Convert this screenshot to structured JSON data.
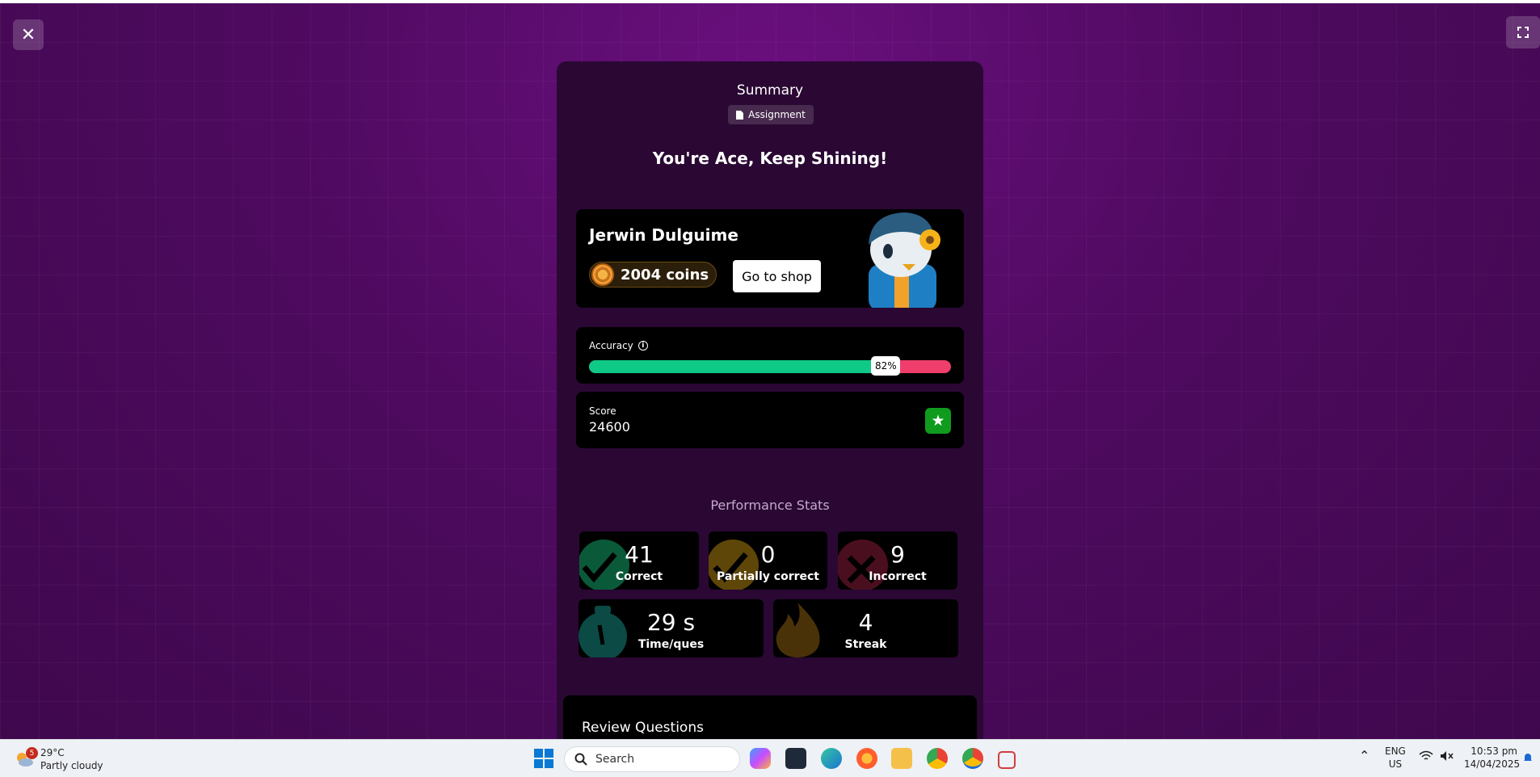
{
  "summary": {
    "title": "Summary",
    "tag_label": "Assignment",
    "headline": "You're Ace, Keep Shining!"
  },
  "profile": {
    "name": "Jerwin Dulguime",
    "coins_label": "2004 coins",
    "shop_button": "Go to shop"
  },
  "accuracy": {
    "label": "Accuracy",
    "percent": 82,
    "percent_label": "82%"
  },
  "score": {
    "label": "Score",
    "value": "24600"
  },
  "performance": {
    "title": "Performance Stats",
    "correct": {
      "value": "41",
      "label": "Correct"
    },
    "partial": {
      "value": "0",
      "label": "Partially correct"
    },
    "incorrect": {
      "value": "9",
      "label": "Incorrect"
    },
    "time": {
      "value": "29 s",
      "label": "Time/ques"
    },
    "streak": {
      "value": "4",
      "label": "Streak"
    }
  },
  "review": {
    "title": "Review Questions"
  },
  "colors": {
    "correct": "#0fc987",
    "incorrect": "#ef3e6b",
    "background": "#4e0a5f"
  },
  "taskbar": {
    "weather_temp": "29°C",
    "weather_desc": "Partly cloudy",
    "weather_badge": "5",
    "search_placeholder": "Search",
    "lang_top": "ENG",
    "lang_bottom": "US",
    "time": "10:53 pm",
    "date": "14/04/2025"
  }
}
